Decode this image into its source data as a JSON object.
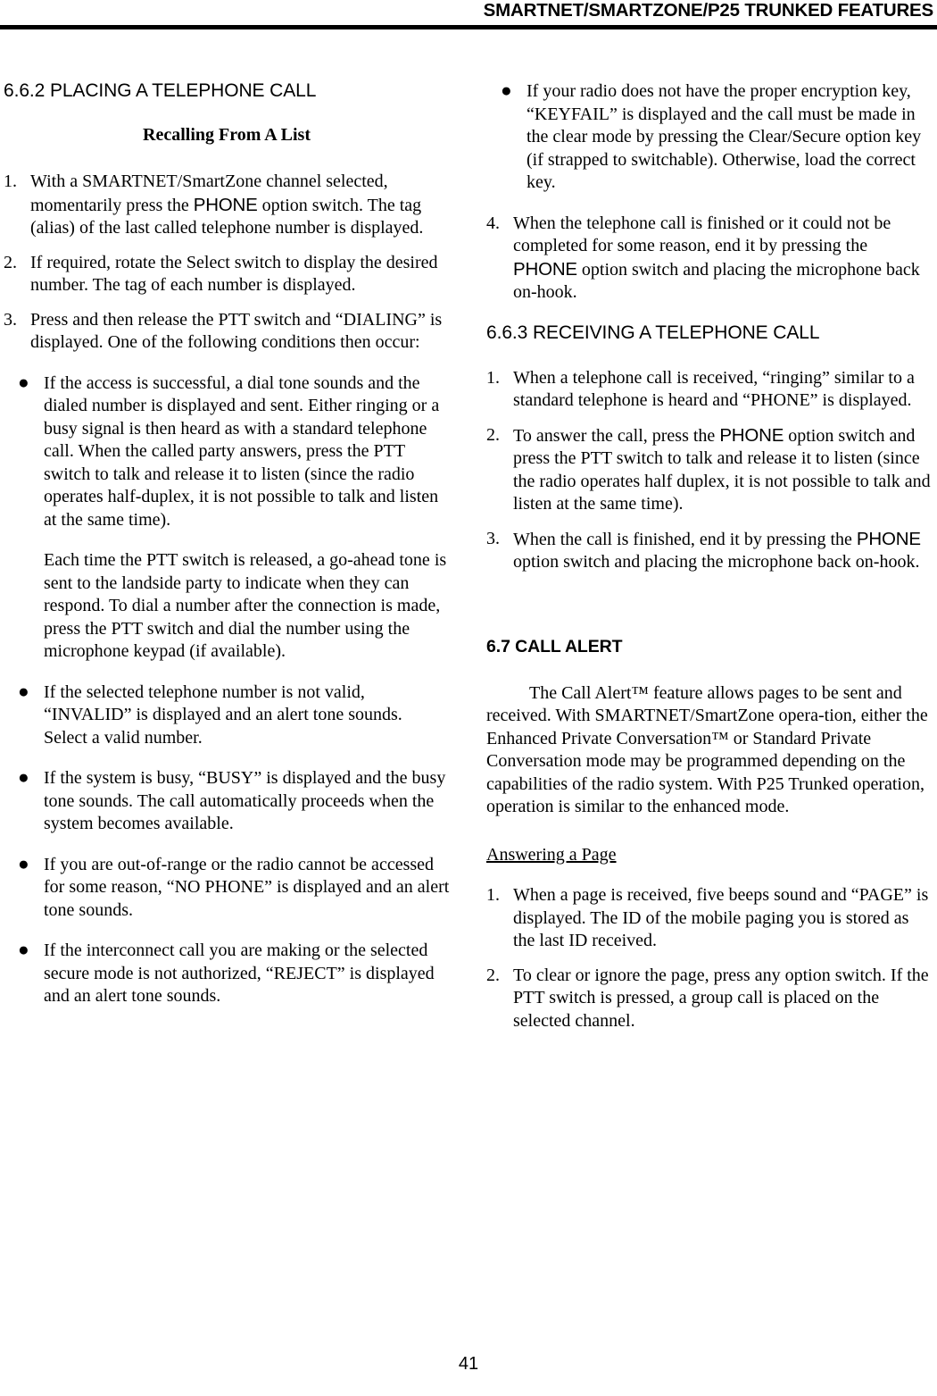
{
  "header": {
    "title": "SMARTNET/SMARTZONE/P25 TRUNKED FEATURES"
  },
  "footer": {
    "page_number": "41"
  },
  "left_column": {
    "section_662_heading": "6.6.2  PLACING A TELEPHONE CALL",
    "subheading": "Recalling From A List",
    "item1": {
      "number": "1.",
      "text_before": "With a SMARTNET/SmartZone channel selected, momentarily press the ",
      "keyword": "PHONE",
      "text_after": " option switch. The tag (alias) of the last called telephone number is displayed."
    },
    "item2": {
      "number": "2.",
      "text": "If required, rotate the Select switch to display the desired number. The tag of each number is displayed."
    },
    "item3": {
      "number": "3.",
      "text": "Press and then release the PTT switch and “DIALING” is displayed. One of the following conditions then occur:"
    },
    "bullet1": "If the access is successful, a dial tone sounds and the dialed number is displayed and sent. Either ringing or a busy signal is then heard as with a standard telephone call. When the called party answers, press the PTT switch to talk and release it to listen (since the radio operates half-duplex, it is not possible to talk and listen at the same time).",
    "bullet1_continuation": "Each time the PTT switch is released, a go-ahead tone is sent to the landside party to indicate when they can respond. To dial a number after the connection is made, press the PTT switch and dial the number using the microphone keypad (if available).",
    "bullet2": "If the selected telephone number is not valid, “INVALID” is displayed and an alert tone sounds. Select a valid number.",
    "bullet3": "If the system is busy, “BUSY” is displayed and the busy tone sounds. The call automatically proceeds when the system becomes available.",
    "bullet4": "If you are out-of-range or the radio cannot be accessed for some reason, “NO PHONE” is displayed and an alert tone sounds.",
    "bullet5": "If the interconnect call you are making or the selected secure mode is not authorized, “REJECT” is displayed and an alert tone sounds.",
    "bullet_glyph": "●"
  },
  "right_column": {
    "bullet1": "If your radio does not have the proper encryption key, “KEYFAIL” is displayed and the call must be made in the clear mode by pressing the Clear/Secure option key (if strapped to switchable). Otherwise, load the correct key.",
    "item4": {
      "number": "4.",
      "text_before": "When the telephone call is finished or it could not be completed for some reason, end it by pressing the ",
      "keyword": "PHONE",
      "text_after": " option switch and placing the microphone back on-hook."
    },
    "section_663_heading": "6.6.3  RECEIVING A TELEPHONE CALL",
    "recv_item1": {
      "number": "1.",
      "text": "When a telephone call is received, “ringing” similar to a standard telephone is heard and “PHONE” is displayed."
    },
    "recv_item2": {
      "number": "2.",
      "text_before": "To answer the call, press the ",
      "keyword": "PHONE",
      "text_after": " option switch and press the PTT switch to talk and release it to listen (since the radio operates half duplex, it is not possible to talk and listen at the same time)."
    },
    "recv_item3": {
      "number": "3.",
      "text_before": "When the call is finished, end it by pressing the ",
      "keyword": "PHONE",
      "text_after": " option switch and placing the microphone back on-hook."
    },
    "section_67_heading": "6.7 CALL ALERT",
    "call_alert_paragraph": "The Call Alert™ feature allows pages to be sent and received. With SMARTNET/SmartZone opera-tion, either the Enhanced Private Conversation™ or Standard Private Conversation mode may be programmed depending on the capabilities of the radio system. With P25 Trunked operation, operation is similar to the enhanced mode.",
    "answering_heading": "Answering a Page",
    "page_item1": {
      "number": "1.",
      "text": "When a page is received, five beeps sound and “PAGE” is displayed. The ID of the mobile paging you is stored as the last ID received."
    },
    "page_item2": {
      "number": "2.",
      "text": "To clear or ignore the page, press any option switch. If the PTT switch is pressed, a group call is placed on the selected channel."
    },
    "bullet_glyph": "●"
  }
}
